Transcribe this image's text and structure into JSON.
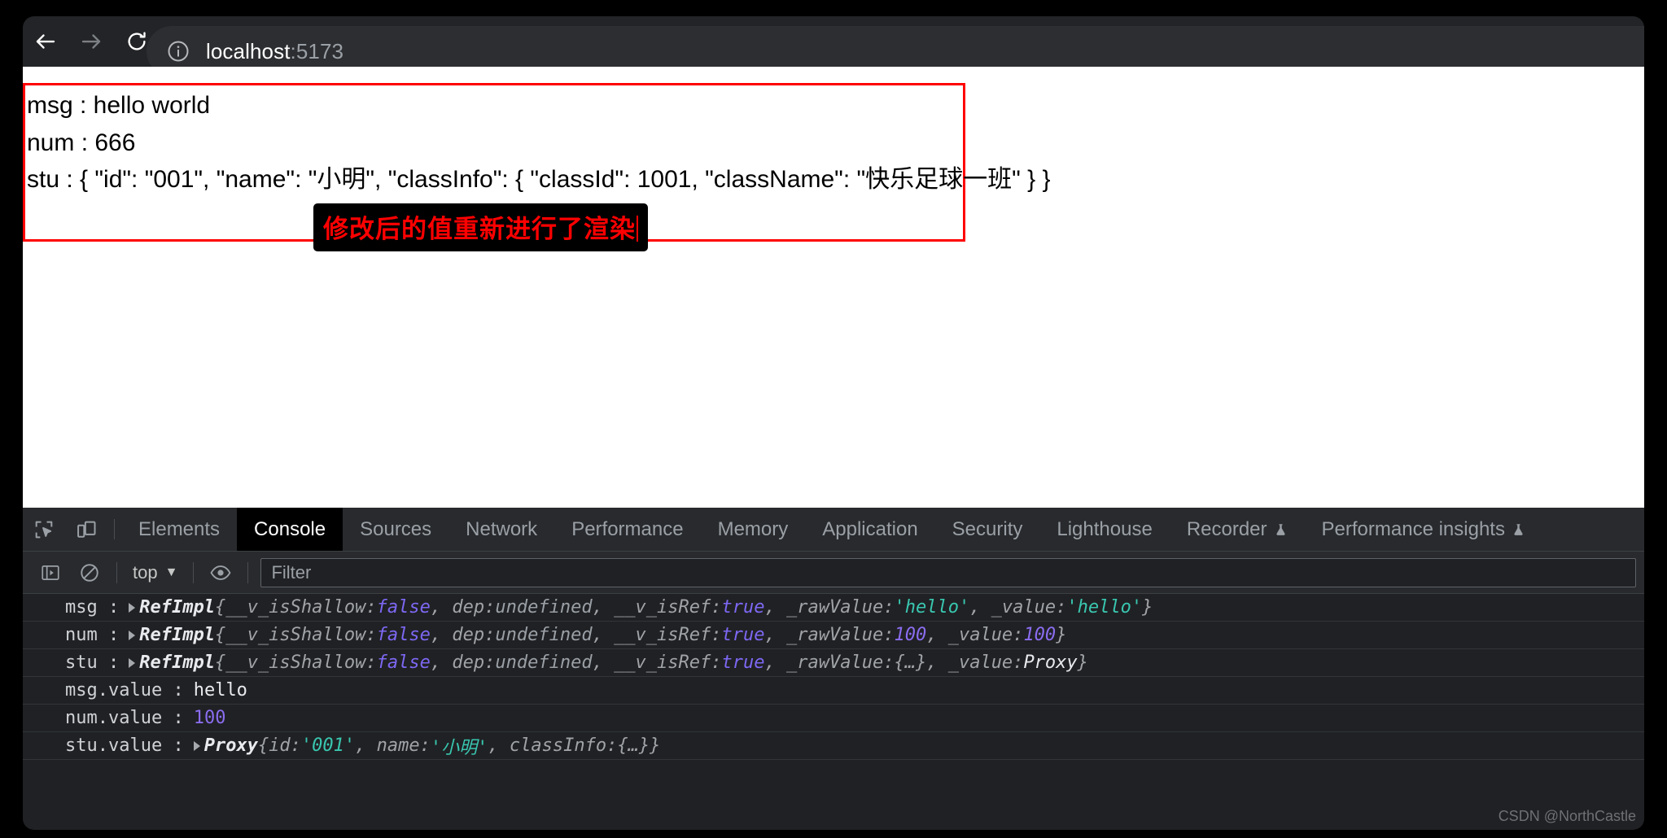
{
  "browser": {
    "nav": {
      "back_label": "Back",
      "forward_label": "Forward",
      "reload_label": "Reload"
    },
    "omnibox": {
      "host": "localhost",
      "port": ":5173",
      "site_info_label": "View site information"
    }
  },
  "page": {
    "lines": [
      "msg : hello world",
      "num : 666",
      "stu : { \"id\": \"001\", \"name\": \"小明\", \"classInfo\": { \"classId\": 1001, \"className\": \"快乐足球一班\" } }"
    ],
    "annotation": {
      "text": "修改后的值重新进行了渲染",
      "text_color": "#ff0000",
      "background_color": "#000000"
    },
    "border_color": "#ff0000"
  },
  "devtools": {
    "left_buttons": [
      {
        "name": "inspect-element",
        "label": "Inspect element"
      },
      {
        "name": "device-toolbar",
        "label": "Toggle device toolbar"
      }
    ],
    "tabs": [
      {
        "label": "Elements",
        "active": false,
        "flask": false
      },
      {
        "label": "Console",
        "active": true,
        "flask": false
      },
      {
        "label": "Sources",
        "active": false,
        "flask": false
      },
      {
        "label": "Network",
        "active": false,
        "flask": false
      },
      {
        "label": "Performance",
        "active": false,
        "flask": false
      },
      {
        "label": "Memory",
        "active": false,
        "flask": false
      },
      {
        "label": "Application",
        "active": false,
        "flask": false
      },
      {
        "label": "Security",
        "active": false,
        "flask": false
      },
      {
        "label": "Lighthouse",
        "active": false,
        "flask": false
      },
      {
        "label": "Recorder",
        "active": false,
        "flask": true
      },
      {
        "label": "Performance insights",
        "active": false,
        "flask": true
      }
    ],
    "console_toolbar": {
      "sidebar_label": "Show console sidebar",
      "clear_label": "Clear console",
      "context": "top",
      "context_caret": "▼",
      "eye_label": "Create live expression",
      "filter_placeholder": "Filter"
    },
    "console_rows": [
      {
        "label": "msg :",
        "expandable": true,
        "obj_name": "RefImpl",
        "tokens": [
          {
            "t": "body",
            "v": "{__v_isShallow: "
          },
          {
            "t": "bool",
            "v": "false"
          },
          {
            "t": "body",
            "v": ", dep: "
          },
          {
            "t": "undef",
            "v": "undefined"
          },
          {
            "t": "body",
            "v": ", __v_isRef: "
          },
          {
            "t": "bool",
            "v": "true"
          },
          {
            "t": "body",
            "v": ", _rawValue: "
          },
          {
            "t": "str",
            "v": "'hello'"
          },
          {
            "t": "body",
            "v": ", _value: "
          },
          {
            "t": "str",
            "v": "'hello'"
          },
          {
            "t": "body",
            "v": "}"
          }
        ]
      },
      {
        "label": "num :",
        "expandable": true,
        "obj_name": "RefImpl",
        "tokens": [
          {
            "t": "body",
            "v": "{__v_isShallow: "
          },
          {
            "t": "bool",
            "v": "false"
          },
          {
            "t": "body",
            "v": ", dep: "
          },
          {
            "t": "undef",
            "v": "undefined"
          },
          {
            "t": "body",
            "v": ", __v_isRef: "
          },
          {
            "t": "bool",
            "v": "true"
          },
          {
            "t": "body",
            "v": ", _rawValue: "
          },
          {
            "t": "num",
            "v": "100"
          },
          {
            "t": "body",
            "v": ", _value: "
          },
          {
            "t": "num",
            "v": "100"
          },
          {
            "t": "body",
            "v": "}"
          }
        ]
      },
      {
        "label": "stu :",
        "expandable": true,
        "obj_name": "RefImpl",
        "tokens": [
          {
            "t": "body",
            "v": "{__v_isShallow: "
          },
          {
            "t": "bool",
            "v": "false"
          },
          {
            "t": "body",
            "v": ", dep: "
          },
          {
            "t": "undef",
            "v": "undefined"
          },
          {
            "t": "body",
            "v": ", __v_isRef: "
          },
          {
            "t": "bool",
            "v": "true"
          },
          {
            "t": "body",
            "v": ", _rawValue: "
          },
          {
            "t": "body",
            "v": "{…}"
          },
          {
            "t": "body",
            "v": ", _value: "
          },
          {
            "t": "proxy",
            "v": "Proxy"
          },
          {
            "t": "body",
            "v": "}"
          }
        ]
      },
      {
        "label": "msg.value :",
        "expandable": false,
        "obj_name": "",
        "tokens": [
          {
            "t": "plain",
            "v": "hello"
          }
        ]
      },
      {
        "label": "num.value :",
        "expandable": false,
        "obj_name": "",
        "tokens": [
          {
            "t": "plainnum",
            "v": "100"
          }
        ]
      },
      {
        "label": "stu.value :",
        "expandable": true,
        "obj_name": "Proxy",
        "tokens": [
          {
            "t": "body",
            "v": "{id: "
          },
          {
            "t": "str",
            "v": "'001'"
          },
          {
            "t": "body",
            "v": ", name: "
          },
          {
            "t": "str",
            "v": "'小明'"
          },
          {
            "t": "body",
            "v": ", classInfo: "
          },
          {
            "t": "body",
            "v": "{…}"
          },
          {
            "t": "body",
            "v": "}"
          }
        ]
      }
    ]
  },
  "watermark": "CSDN @NorthCastle"
}
